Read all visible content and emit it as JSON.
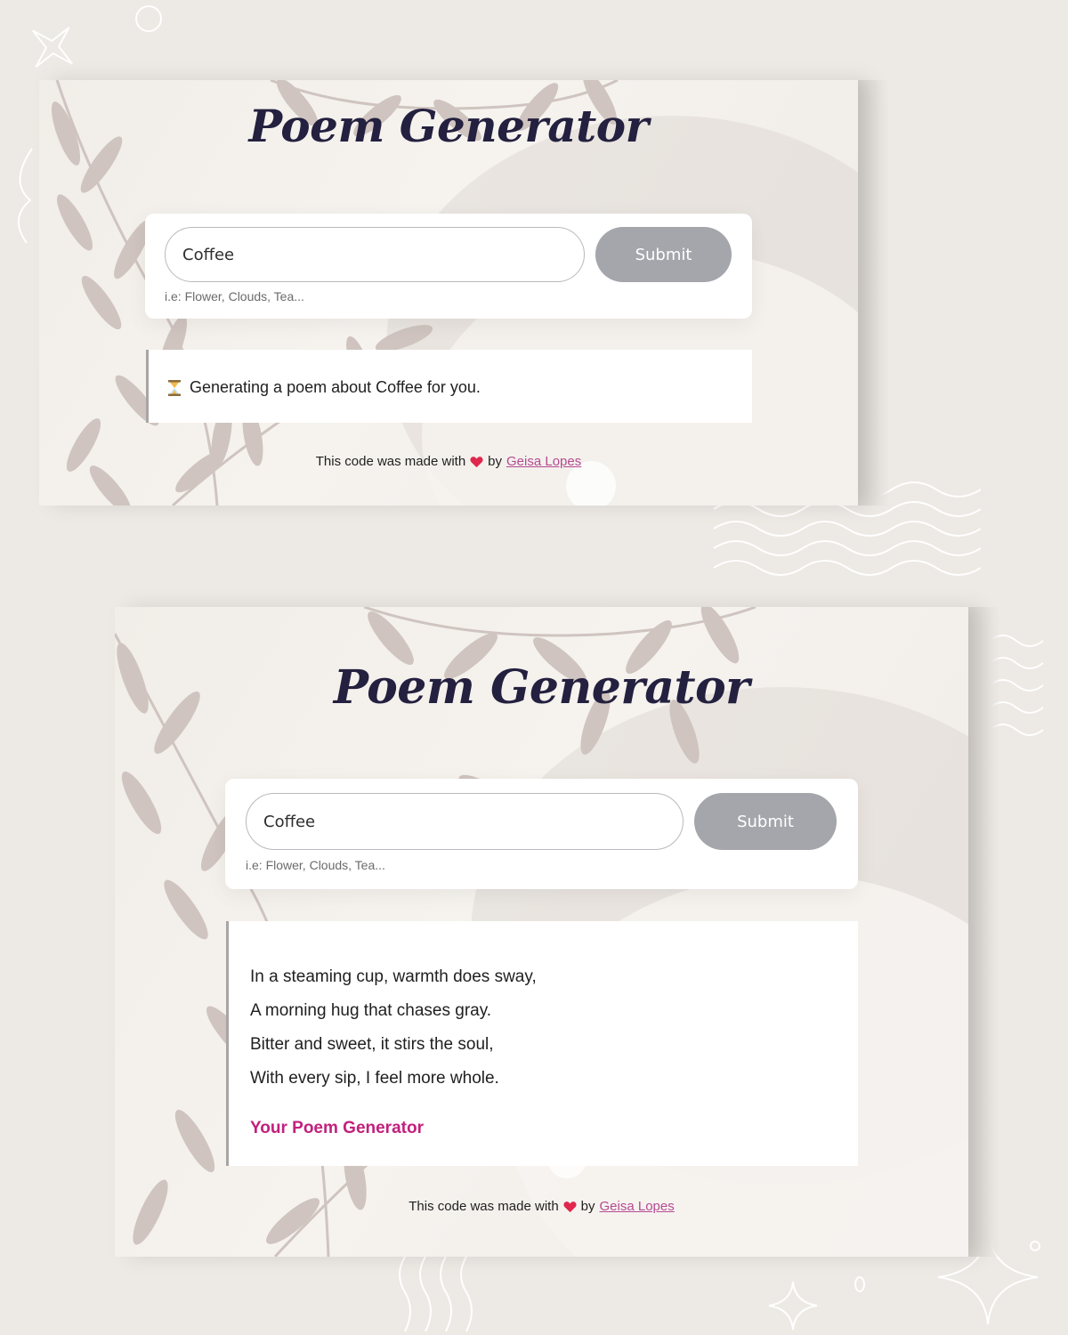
{
  "colors": {
    "page_bg": "#ede9e4",
    "title": "#24203f",
    "submit_bg": "#a4a6ab",
    "signature": "#c1207c",
    "author_link": "#b44a93",
    "heart": "#e0284f"
  },
  "screens": [
    {
      "title": "Poem Generator",
      "form": {
        "input_value": "Coffee",
        "submit_label": "Submit",
        "hint": "i.e: Flower, Clouds, Tea..."
      },
      "status": {
        "icon": "hourglass-icon",
        "text": "Generating a poem about Coffee for you."
      },
      "footer": {
        "prefix": "This code was made with",
        "icon": "heart-icon",
        "by": "by",
        "author": "Geisa Lopes"
      }
    },
    {
      "title": "Poem Generator",
      "form": {
        "input_value": "Coffee",
        "submit_label": "Submit",
        "hint": "i.e: Flower, Clouds, Tea..."
      },
      "poem": {
        "lines": [
          "In a steaming cup, warmth does sway,",
          "A morning hug that chases gray.",
          "Bitter and sweet, it stirs the soul,",
          "With every sip, I feel more whole."
        ],
        "signature": "Your Poem Generator"
      },
      "footer": {
        "prefix": "This code was made with",
        "icon": "heart-icon",
        "by": "by",
        "author": "Geisa Lopes"
      }
    }
  ]
}
